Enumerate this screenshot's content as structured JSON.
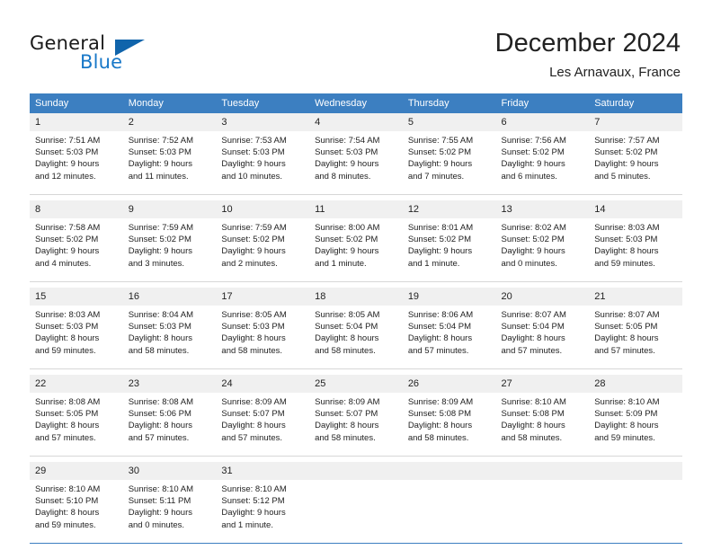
{
  "brand": {
    "name_part1": "General",
    "name_part2": "Blue",
    "accent_color": "#1878c8",
    "logo_triangle_color": "#1064ab"
  },
  "header": {
    "month_title": "December 2024",
    "location": "Les Arnavaux, France"
  },
  "calendar": {
    "header_bg": "#3c7fc1",
    "daynum_bg": "#f0f0f0",
    "weekdays": [
      "Sunday",
      "Monday",
      "Tuesday",
      "Wednesday",
      "Thursday",
      "Friday",
      "Saturday"
    ],
    "weeks": [
      [
        {
          "day": "1",
          "sunrise": "Sunrise: 7:51 AM",
          "sunset": "Sunset: 5:03 PM",
          "daylight1": "Daylight: 9 hours",
          "daylight2": "and 12 minutes."
        },
        {
          "day": "2",
          "sunrise": "Sunrise: 7:52 AM",
          "sunset": "Sunset: 5:03 PM",
          "daylight1": "Daylight: 9 hours",
          "daylight2": "and 11 minutes."
        },
        {
          "day": "3",
          "sunrise": "Sunrise: 7:53 AM",
          "sunset": "Sunset: 5:03 PM",
          "daylight1": "Daylight: 9 hours",
          "daylight2": "and 10 minutes."
        },
        {
          "day": "4",
          "sunrise": "Sunrise: 7:54 AM",
          "sunset": "Sunset: 5:03 PM",
          "daylight1": "Daylight: 9 hours",
          "daylight2": "and 8 minutes."
        },
        {
          "day": "5",
          "sunrise": "Sunrise: 7:55 AM",
          "sunset": "Sunset: 5:02 PM",
          "daylight1": "Daylight: 9 hours",
          "daylight2": "and 7 minutes."
        },
        {
          "day": "6",
          "sunrise": "Sunrise: 7:56 AM",
          "sunset": "Sunset: 5:02 PM",
          "daylight1": "Daylight: 9 hours",
          "daylight2": "and 6 minutes."
        },
        {
          "day": "7",
          "sunrise": "Sunrise: 7:57 AM",
          "sunset": "Sunset: 5:02 PM",
          "daylight1": "Daylight: 9 hours",
          "daylight2": "and 5 minutes."
        }
      ],
      [
        {
          "day": "8",
          "sunrise": "Sunrise: 7:58 AM",
          "sunset": "Sunset: 5:02 PM",
          "daylight1": "Daylight: 9 hours",
          "daylight2": "and 4 minutes."
        },
        {
          "day": "9",
          "sunrise": "Sunrise: 7:59 AM",
          "sunset": "Sunset: 5:02 PM",
          "daylight1": "Daylight: 9 hours",
          "daylight2": "and 3 minutes."
        },
        {
          "day": "10",
          "sunrise": "Sunrise: 7:59 AM",
          "sunset": "Sunset: 5:02 PM",
          "daylight1": "Daylight: 9 hours",
          "daylight2": "and 2 minutes."
        },
        {
          "day": "11",
          "sunrise": "Sunrise: 8:00 AM",
          "sunset": "Sunset: 5:02 PM",
          "daylight1": "Daylight: 9 hours",
          "daylight2": "and 1 minute."
        },
        {
          "day": "12",
          "sunrise": "Sunrise: 8:01 AM",
          "sunset": "Sunset: 5:02 PM",
          "daylight1": "Daylight: 9 hours",
          "daylight2": "and 1 minute."
        },
        {
          "day": "13",
          "sunrise": "Sunrise: 8:02 AM",
          "sunset": "Sunset: 5:02 PM",
          "daylight1": "Daylight: 9 hours",
          "daylight2": "and 0 minutes."
        },
        {
          "day": "14",
          "sunrise": "Sunrise: 8:03 AM",
          "sunset": "Sunset: 5:03 PM",
          "daylight1": "Daylight: 8 hours",
          "daylight2": "and 59 minutes."
        }
      ],
      [
        {
          "day": "15",
          "sunrise": "Sunrise: 8:03 AM",
          "sunset": "Sunset: 5:03 PM",
          "daylight1": "Daylight: 8 hours",
          "daylight2": "and 59 minutes."
        },
        {
          "day": "16",
          "sunrise": "Sunrise: 8:04 AM",
          "sunset": "Sunset: 5:03 PM",
          "daylight1": "Daylight: 8 hours",
          "daylight2": "and 58 minutes."
        },
        {
          "day": "17",
          "sunrise": "Sunrise: 8:05 AM",
          "sunset": "Sunset: 5:03 PM",
          "daylight1": "Daylight: 8 hours",
          "daylight2": "and 58 minutes."
        },
        {
          "day": "18",
          "sunrise": "Sunrise: 8:05 AM",
          "sunset": "Sunset: 5:04 PM",
          "daylight1": "Daylight: 8 hours",
          "daylight2": "and 58 minutes."
        },
        {
          "day": "19",
          "sunrise": "Sunrise: 8:06 AM",
          "sunset": "Sunset: 5:04 PM",
          "daylight1": "Daylight: 8 hours",
          "daylight2": "and 57 minutes."
        },
        {
          "day": "20",
          "sunrise": "Sunrise: 8:07 AM",
          "sunset": "Sunset: 5:04 PM",
          "daylight1": "Daylight: 8 hours",
          "daylight2": "and 57 minutes."
        },
        {
          "day": "21",
          "sunrise": "Sunrise: 8:07 AM",
          "sunset": "Sunset: 5:05 PM",
          "daylight1": "Daylight: 8 hours",
          "daylight2": "and 57 minutes."
        }
      ],
      [
        {
          "day": "22",
          "sunrise": "Sunrise: 8:08 AM",
          "sunset": "Sunset: 5:05 PM",
          "daylight1": "Daylight: 8 hours",
          "daylight2": "and 57 minutes."
        },
        {
          "day": "23",
          "sunrise": "Sunrise: 8:08 AM",
          "sunset": "Sunset: 5:06 PM",
          "daylight1": "Daylight: 8 hours",
          "daylight2": "and 57 minutes."
        },
        {
          "day": "24",
          "sunrise": "Sunrise: 8:09 AM",
          "sunset": "Sunset: 5:07 PM",
          "daylight1": "Daylight: 8 hours",
          "daylight2": "and 57 minutes."
        },
        {
          "day": "25",
          "sunrise": "Sunrise: 8:09 AM",
          "sunset": "Sunset: 5:07 PM",
          "daylight1": "Daylight: 8 hours",
          "daylight2": "and 58 minutes."
        },
        {
          "day": "26",
          "sunrise": "Sunrise: 8:09 AM",
          "sunset": "Sunset: 5:08 PM",
          "daylight1": "Daylight: 8 hours",
          "daylight2": "and 58 minutes."
        },
        {
          "day": "27",
          "sunrise": "Sunrise: 8:10 AM",
          "sunset": "Sunset: 5:08 PM",
          "daylight1": "Daylight: 8 hours",
          "daylight2": "and 58 minutes."
        },
        {
          "day": "28",
          "sunrise": "Sunrise: 8:10 AM",
          "sunset": "Sunset: 5:09 PM",
          "daylight1": "Daylight: 8 hours",
          "daylight2": "and 59 minutes."
        }
      ],
      [
        {
          "day": "29",
          "sunrise": "Sunrise: 8:10 AM",
          "sunset": "Sunset: 5:10 PM",
          "daylight1": "Daylight: 8 hours",
          "daylight2": "and 59 minutes."
        },
        {
          "day": "30",
          "sunrise": "Sunrise: 8:10 AM",
          "sunset": "Sunset: 5:11 PM",
          "daylight1": "Daylight: 9 hours",
          "daylight2": "and 0 minutes."
        },
        {
          "day": "31",
          "sunrise": "Sunrise: 8:10 AM",
          "sunset": "Sunset: 5:12 PM",
          "daylight1": "Daylight: 9 hours",
          "daylight2": "and 1 minute."
        },
        {
          "day": "",
          "sunrise": "",
          "sunset": "",
          "daylight1": "",
          "daylight2": ""
        },
        {
          "day": "",
          "sunrise": "",
          "sunset": "",
          "daylight1": "",
          "daylight2": ""
        },
        {
          "day": "",
          "sunrise": "",
          "sunset": "",
          "daylight1": "",
          "daylight2": ""
        },
        {
          "day": "",
          "sunrise": "",
          "sunset": "",
          "daylight1": "",
          "daylight2": ""
        }
      ]
    ]
  }
}
